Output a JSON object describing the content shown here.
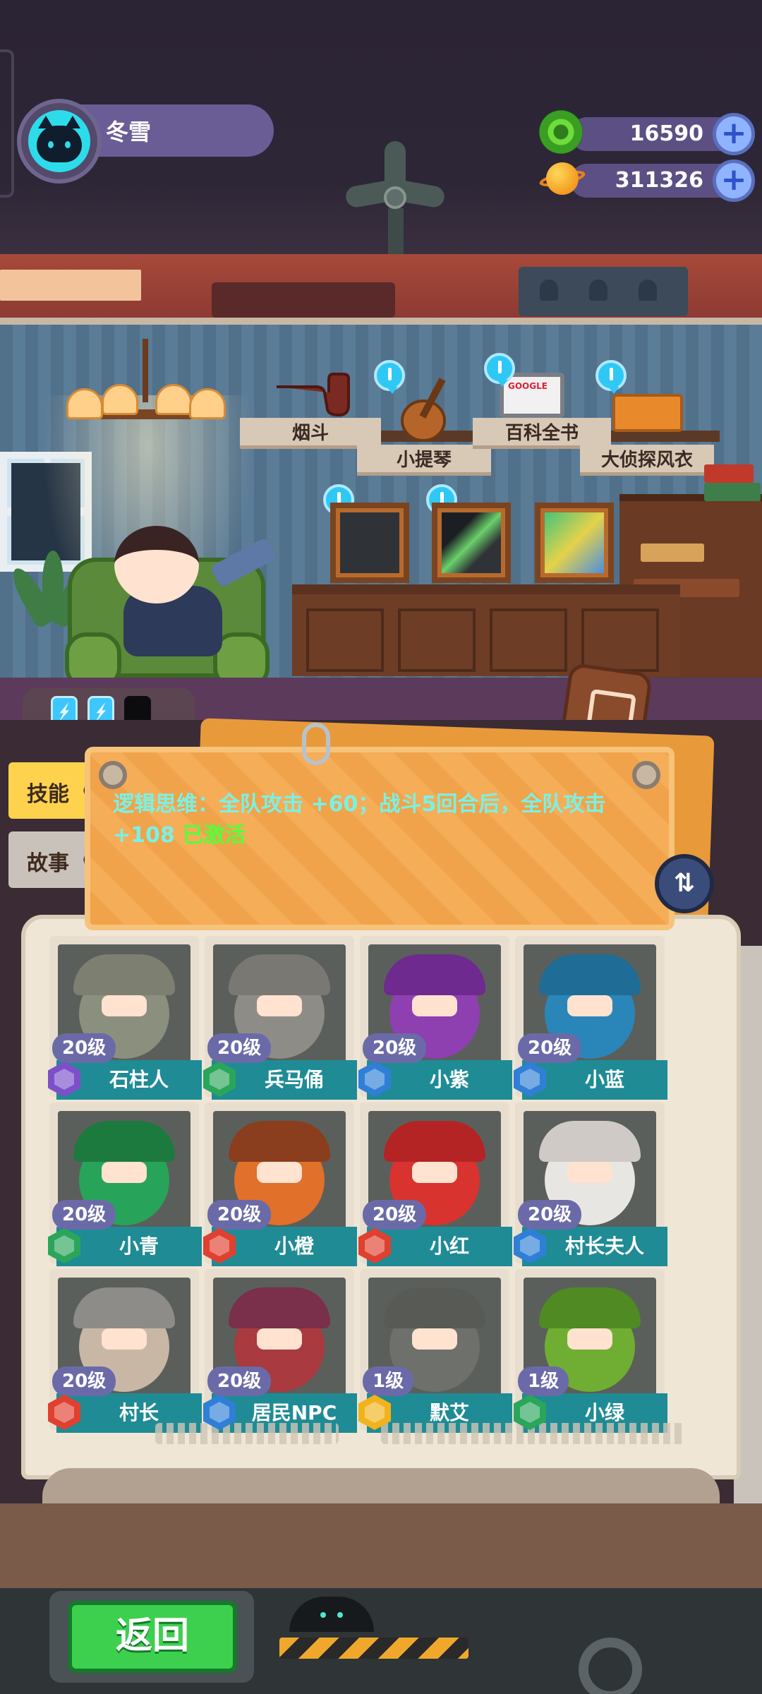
{
  "player": {
    "name": "冬雪"
  },
  "currencies": [
    {
      "id": "green_coin",
      "value": "16590",
      "icon": "green-ring-coin-icon"
    },
    {
      "id": "planet_coin",
      "value": "311326",
      "icon": "planet-coin-icon"
    }
  ],
  "room_items": [
    {
      "label": "烟斗",
      "icon": "pipe-icon"
    },
    {
      "label": "小提琴",
      "icon": "violin-icon"
    },
    {
      "label": "百科全书",
      "icon": "tablet-icon",
      "tablet_text": "GOOGLE"
    },
    {
      "label": "大侦探风衣",
      "icon": "coat-icon"
    }
  ],
  "energy": {
    "filled": 2,
    "total": 3
  },
  "tabs": [
    {
      "label": "技能",
      "active": true
    },
    {
      "label": "故事",
      "active": false
    }
  ],
  "skill": {
    "text": "逻辑思维：全队攻击 +60；战斗5回合后，全队攻击 +108",
    "status": "已激活"
  },
  "characters": [
    {
      "level": "20级",
      "name": "石柱人",
      "badge_color": "#7d4fc9",
      "body": "#8b8f7e",
      "hat": "#7d8070"
    },
    {
      "level": "20级",
      "name": "兵马俑",
      "badge_color": "#2aa65a",
      "body": "#8e8c86",
      "hat": "#7a7873"
    },
    {
      "level": "20级",
      "name": "小紫",
      "badge_color": "#2f7fd6",
      "body": "#8e3fb0",
      "hat": "#6f2a8f"
    },
    {
      "level": "20级",
      "name": "小蓝",
      "badge_color": "#2f7fd6",
      "body": "#2a86b8",
      "hat": "#1f6c97"
    },
    {
      "level": "20级",
      "name": "小青",
      "badge_color": "#2aa65a",
      "body": "#27a35a",
      "hat": "#1d7a3e"
    },
    {
      "level": "20级",
      "name": "小橙",
      "badge_color": "#e0402f",
      "body": "#e0702a",
      "hat": "#8a3e1d"
    },
    {
      "level": "20级",
      "name": "小红",
      "badge_color": "#e0402f",
      "body": "#d8332f",
      "hat": "#b42424"
    },
    {
      "level": "20级",
      "name": "村长夫人",
      "badge_color": "#2f7fd6",
      "body": "#e8e6e3",
      "hat": "#cfcac5"
    },
    {
      "level": "20级",
      "name": "村长",
      "badge_color": "#e0402f",
      "body": "#c9b7a6",
      "hat": "#8d8c88"
    },
    {
      "level": "20级",
      "name": "居民NPC",
      "badge_color": "#2f7fd6",
      "body": "#a83a40",
      "hat": "#7a2f4a"
    },
    {
      "level": "1级",
      "name": "默艾",
      "badge_color": "#f2b21c",
      "body": "#6d706b",
      "hat": "#585a56"
    },
    {
      "level": "1级",
      "name": "小绿",
      "badge_color": "#2aa65a",
      "body": "#6fae32",
      "hat": "#4f8a22"
    }
  ],
  "back_button": {
    "label": "返回"
  }
}
